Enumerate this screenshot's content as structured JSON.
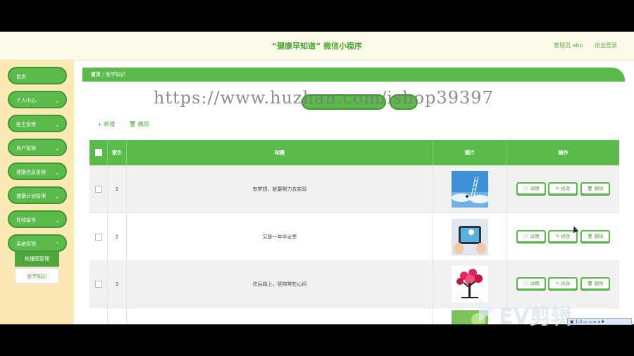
{
  "header": {
    "title": "“健康早知道” 微信小程序",
    "admin_label": "管理员 abo",
    "logout_label": "退出登录"
  },
  "sidebar": {
    "items": [
      {
        "label": "首页",
        "has_chevron": false
      },
      {
        "label": "个人中心",
        "has_chevron": true
      },
      {
        "label": "医生管理",
        "has_chevron": true
      },
      {
        "label": "用户管理",
        "has_chevron": true
      },
      {
        "label": "健康信息管理",
        "has_chevron": true
      },
      {
        "label": "健康计划管理",
        "has_chevron": true
      },
      {
        "label": "在线留言",
        "has_chevron": true
      },
      {
        "label": "系统管理",
        "has_chevron": true
      }
    ],
    "submenu": [
      "轮播图管理",
      "医学知识"
    ]
  },
  "breadcrumb": {
    "home": "首页",
    "separator": "/",
    "current": "医学知识"
  },
  "watermark": "https://www.huzhan.com/ishop39397",
  "toolbar": {
    "add_label": "+ 新增",
    "delete_label": "🗑 删除"
  },
  "table": {
    "headers": [
      "索引",
      "标题",
      "图片",
      "操作"
    ],
    "rows": [
      {
        "index": "1",
        "title": "有梦想，就要努力去实现",
        "image": "sky-ladder-image"
      },
      {
        "index": "2",
        "title": "又是一年毕业季",
        "image": "tablet-hands-image"
      },
      {
        "index": "3",
        "title": "往后路上，坚持常在心间",
        "image": "heart-tree-image"
      }
    ],
    "actions": {
      "detail": "📄 详情",
      "edit": "✎ 修改",
      "delete": "🗑 删除"
    }
  },
  "overlay": {
    "ev_logo": "EV剪辑"
  },
  "colors": {
    "primary": "#5aba4a",
    "sidebar_bg": "#fae9b3",
    "topbar_bg": "#fdfbe9"
  }
}
